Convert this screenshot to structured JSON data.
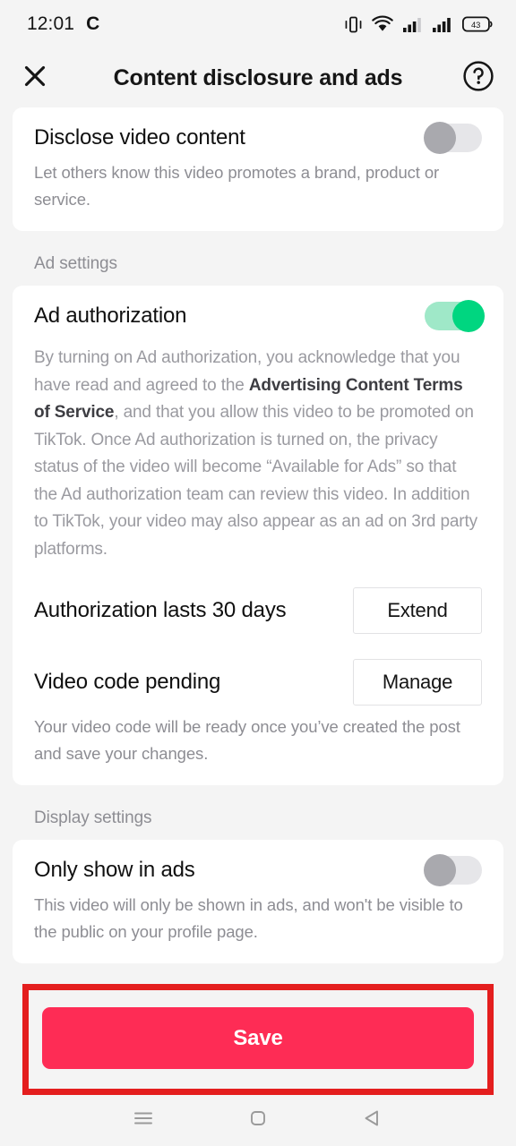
{
  "status_bar": {
    "time": "12:01",
    "app_badge": "C",
    "battery_level": "43",
    "icons": [
      "vibrate-icon",
      "wifi-icon",
      "signal-icon-1",
      "signal-icon-2",
      "battery-icon"
    ]
  },
  "header": {
    "close_icon": "close-icon",
    "title": "Content disclosure and ads",
    "help_icon": "help-circle-icon"
  },
  "disclose_card": {
    "title": "Disclose video content",
    "description": "Let others know this video promotes a brand, product or service.",
    "toggle_state": "off"
  },
  "ad_settings": {
    "section_label": "Ad settings",
    "authorization": {
      "title": "Ad authorization",
      "toggle_state": "on",
      "paragraph_part1": "By turning on Ad authorization, you acknowledge that you have read and agreed to the ",
      "paragraph_bold": "Advertising Content Terms of Service",
      "paragraph_part2": ", and that you allow this video to be promoted on TikTok. Once Ad authorization is turned on, the privacy status of the video will become “Available for Ads” so that the Ad authorization team can review this video. In addition to TikTok, your video may also appear as an ad on 3rd party platforms."
    },
    "duration_row": {
      "label": "Authorization lasts 30 days",
      "button": "Extend"
    },
    "video_code_row": {
      "label": "Video code pending",
      "button": "Manage",
      "description": "Your video code will be ready once you’ve created the post and save your changes."
    }
  },
  "display_settings": {
    "section_label": "Display settings",
    "only_show_in_ads": {
      "title": "Only show in ads",
      "description": "This video will only be shown in ads, and won't be visible to the public on your profile page.",
      "toggle_state": "off"
    }
  },
  "footer": {
    "save_label": "Save",
    "highlight_color": "#e41e1e",
    "save_color": "#fe2c55"
  },
  "nav_bar": {
    "recents_icon": "menu-icon",
    "home_icon": "home-square-icon",
    "back_icon": "back-triangle-icon"
  },
  "colors": {
    "accent": "#fe2c55",
    "toggle_on": "#00d680",
    "background": "#f4f4f4",
    "card": "#ffffff"
  }
}
